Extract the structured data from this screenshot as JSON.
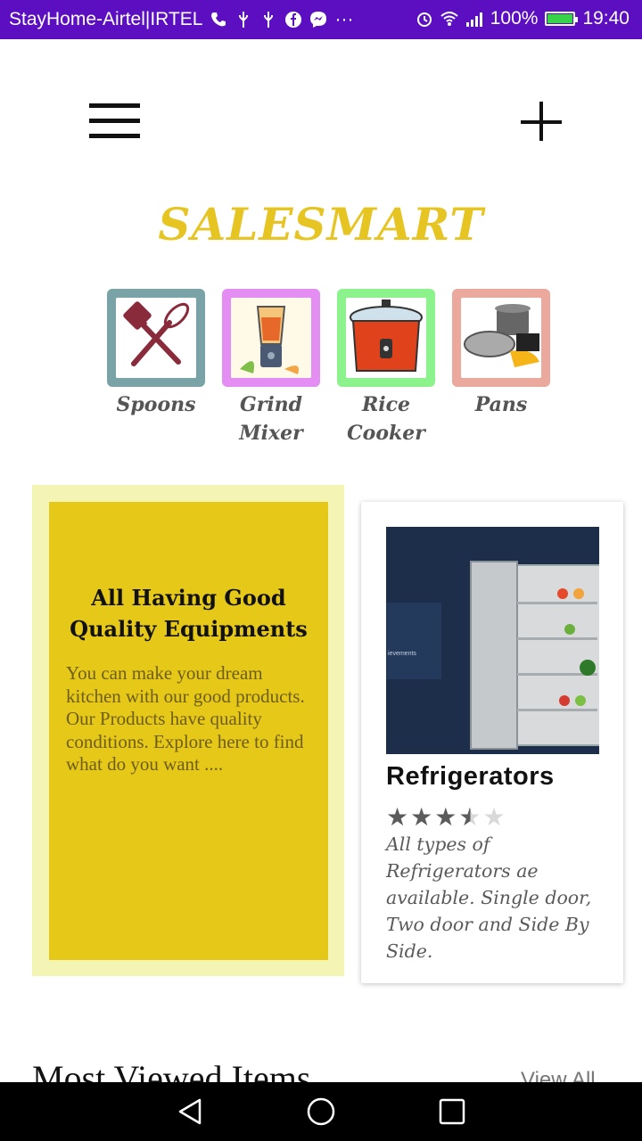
{
  "status_bar": {
    "carrier": "StayHome-Airtel|IRTEL",
    "more": "···",
    "battery_percent": "100%",
    "battery_level": 1.0,
    "time": "19:40",
    "colors": {
      "background": "#5b0fc0",
      "battery_fill": "#38d34a"
    },
    "icons": [
      "phone-icon",
      "usb-icon",
      "usb-icon",
      "facebook-icon",
      "messenger-icon",
      "alarm-icon",
      "wifi-icon",
      "signal-icon",
      "battery-icon"
    ]
  },
  "header": {
    "menu_icon": "hamburger-menu-icon",
    "add_icon": "plus-icon"
  },
  "brand": {
    "title": "SALESMART",
    "color": "#e6c523"
  },
  "categories": [
    {
      "label": "Spoons",
      "border": "#7aa3a7",
      "icon": "utensils-icon"
    },
    {
      "label": "Grind\nMixer",
      "border": "#e48ef4",
      "icon": "blender-icon"
    },
    {
      "label": "Rice\nCooker",
      "border": "#8cf28c",
      "icon": "rice-cooker-icon"
    },
    {
      "label": "Pans",
      "border": "#eaa99c",
      "icon": "pans-icon"
    }
  ],
  "promo": {
    "title": "All Having Good Quality Equipments",
    "body": "You can make your dream kitchen with our good products. Our Products have quality conditions. Explore here to find what do you want ....",
    "colors": {
      "outer": "#f4f5b5",
      "inner": "#e5c818"
    }
  },
  "product": {
    "name": "Refrigerators",
    "rating": 3.5,
    "rating_max": 5,
    "image_text": "ievements",
    "description": "All types of Refrigerators ae available. Single door, Two door and Side By Side."
  },
  "section": {
    "title": "Most Viewed Items",
    "view_all": "View All"
  },
  "navigation": {
    "buttons": [
      "back-icon",
      "home-icon",
      "recents-icon"
    ]
  }
}
